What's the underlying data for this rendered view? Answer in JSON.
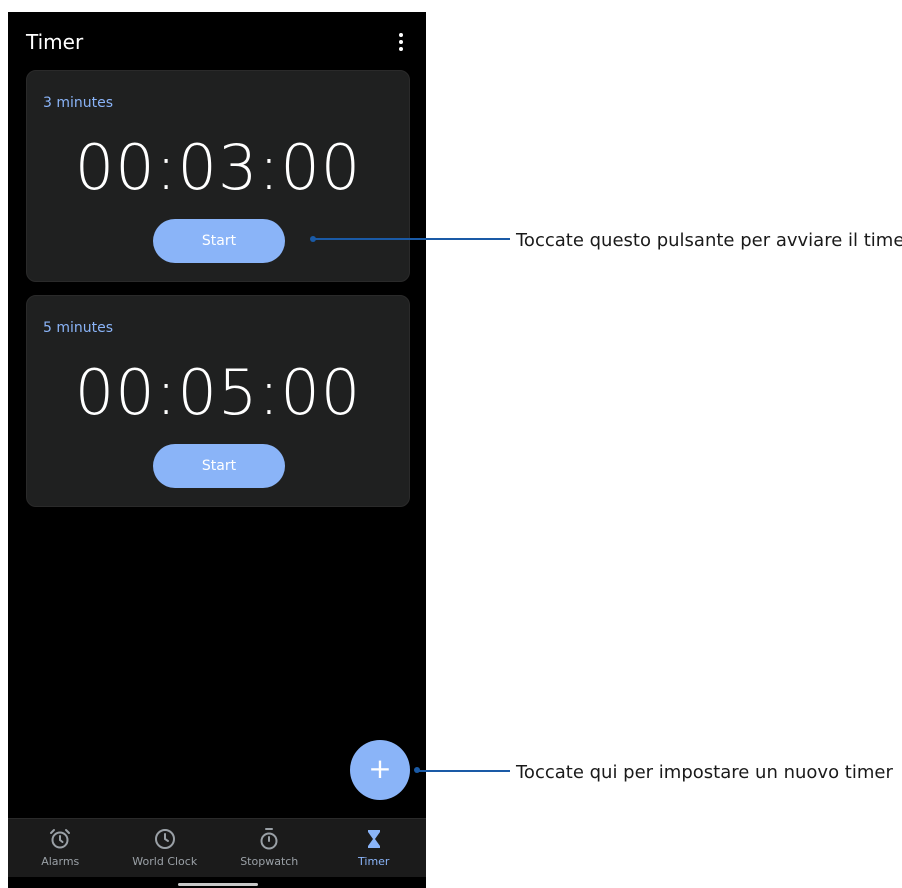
{
  "app": {
    "title": "Timer"
  },
  "timers": [
    {
      "label": "3 minutes",
      "time": "00:03:00",
      "start_label": "Start"
    },
    {
      "label": "5 minutes",
      "time": "00:05:00",
      "start_label": "Start"
    }
  ],
  "fab": {
    "icon": "plus-icon",
    "glyph": "+"
  },
  "bottom_nav": {
    "items": [
      {
        "label": "Alarms",
        "icon": "alarm-icon"
      },
      {
        "label": "World Clock",
        "icon": "clock-icon"
      },
      {
        "label": "Stopwatch",
        "icon": "stopwatch-icon"
      },
      {
        "label": "Timer",
        "icon": "hourglass-icon",
        "active": true
      }
    ]
  },
  "callouts": {
    "start": "Toccate questo pulsante per avviare il timer",
    "new": "Toccate qui per impostare un nuovo timer"
  },
  "colors": {
    "accent": "#8ab4f8",
    "background": "#000000",
    "card": "#1f2020",
    "callout_line": "#1a5aa6"
  }
}
